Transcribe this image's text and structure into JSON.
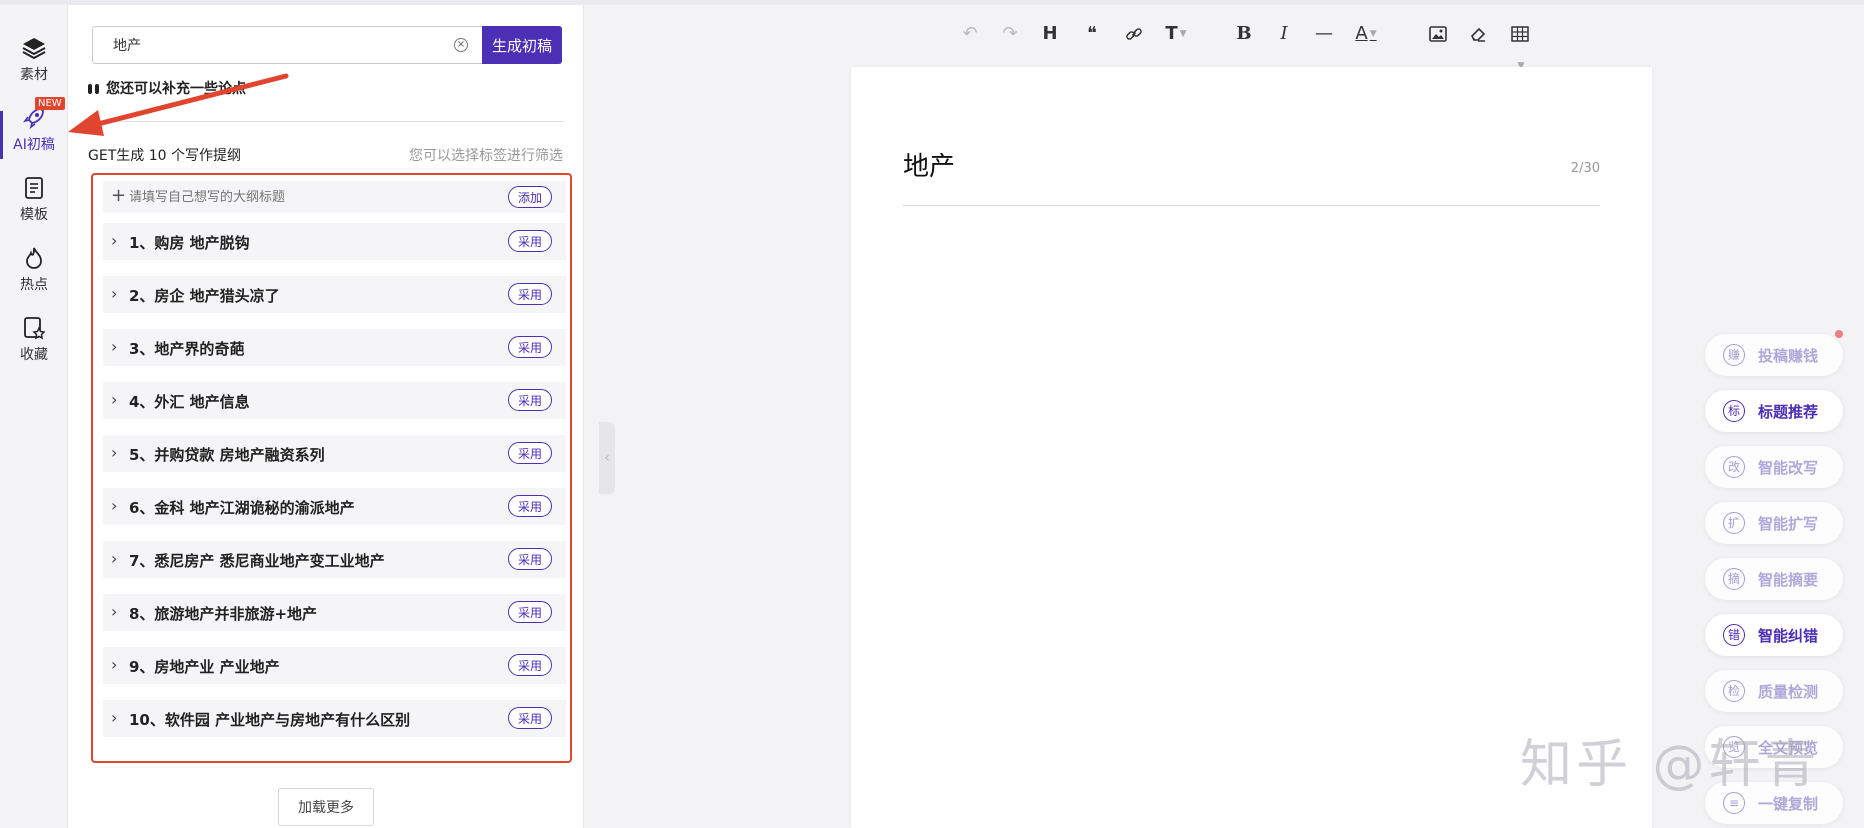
{
  "rail": {
    "items": [
      {
        "label": "素材",
        "icon": "layers-icon"
      },
      {
        "label": "AI初稿",
        "icon": "rocket-icon",
        "badge": "NEW",
        "active": true
      },
      {
        "label": "模板",
        "icon": "document-icon"
      },
      {
        "label": "热点",
        "icon": "flame-icon"
      },
      {
        "label": "收藏",
        "icon": "star-doc-icon"
      }
    ]
  },
  "panel": {
    "search_value": "地产",
    "generate_label": "生成初稿",
    "supplement_label": "您还可以补充一些论点",
    "get_title": "GET生成 10 个写作提纲",
    "filter_hint": "您可以选择标签进行筛选",
    "add_placeholder": "请填写自己想写的大纲标题",
    "add_label": "添加",
    "use_label": "采用",
    "outlines": [
      "1、购房 地产脱钩",
      "2、房企 地产猎头凉了",
      "3、地产界的奇葩",
      "4、外汇 地产信息",
      "5、并购贷款 房地产融资系列",
      "6、金科 地产江湖诡秘的渝派地产",
      "7、悉尼房产 悉尼商业地产变工业地产",
      "8、旅游地产并非旅游+地产",
      "9、房地产业 产业地产",
      "10、软件园 产业地产与房地产有什么区别"
    ],
    "load_more": "加载更多"
  },
  "toolbar": {
    "items": [
      "undo-icon",
      "redo-icon",
      "heading-icon",
      "quote-icon",
      "link-icon",
      "text-size-icon",
      "bold-icon",
      "italic-icon",
      "divider-icon",
      "font-color-icon",
      "image-icon",
      "eraser-icon",
      "table-icon"
    ],
    "heading": "H",
    "quote": "❝",
    "text_size": "T",
    "bold": "B",
    "italic": "I",
    "font_color": "A"
  },
  "document": {
    "title": "地产",
    "count": "2/30"
  },
  "tools": [
    {
      "icon_char": "赚",
      "label": "投稿赚钱",
      "style": "faded",
      "dot": true
    },
    {
      "icon_char": "标",
      "label": "标题推荐",
      "style": "strong"
    },
    {
      "icon_char": "改",
      "label": "智能改写",
      "style": "faded"
    },
    {
      "icon_char": "扩",
      "label": "智能扩写",
      "style": "faded"
    },
    {
      "icon_char": "摘",
      "label": "智能摘要",
      "style": "faded"
    },
    {
      "icon_char": "错",
      "label": "智能纠错",
      "style": "strong"
    },
    {
      "icon_char": "检",
      "label": "质量检测",
      "style": "faded"
    },
    {
      "icon_char": "览",
      "label": "全文预览",
      "style": "faded"
    },
    {
      "icon_char": "≡",
      "label": "一键复制",
      "style": "faded"
    }
  ],
  "watermark": "知乎 @轩青",
  "colors": {
    "accent": "#4b2fb5",
    "annotation_red": "#e2452f"
  }
}
